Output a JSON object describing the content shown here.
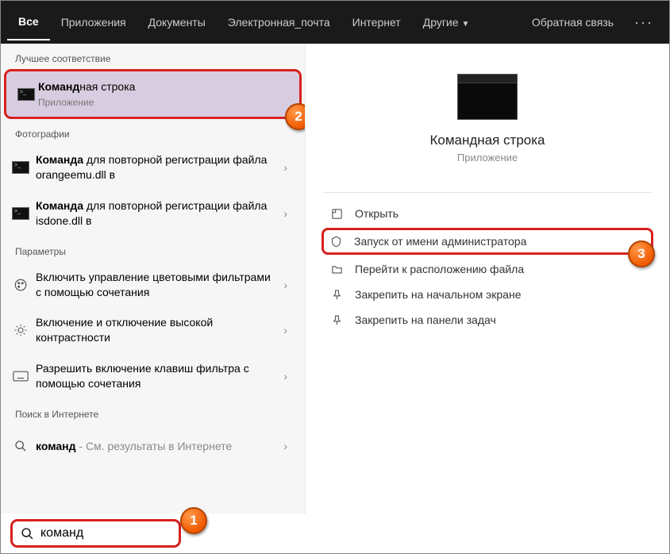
{
  "topbar": {
    "tabs": [
      {
        "label": "Все",
        "active": true
      },
      {
        "label": "Приложения"
      },
      {
        "label": "Документы"
      },
      {
        "label": "Электронная_почта"
      },
      {
        "label": "Интернет"
      },
      {
        "label": "Другие",
        "dropdown": true
      }
    ],
    "feedback": "Обратная связь"
  },
  "sections": {
    "best_match": "Лучшее соответствие",
    "photos": "Фотографии",
    "settings": "Параметры",
    "web": "Поиск в Интернете"
  },
  "results": {
    "best": {
      "bold": "Команд",
      "rest": "ная строка",
      "sub": "Приложение"
    },
    "photo1": {
      "bold": "Команда",
      "rest": " для повторной регистрации файла orangeemu.dll в"
    },
    "photo2": {
      "bold": "Команда",
      "rest": " для повторной регистрации файла isdone.dll в"
    },
    "set1": "Включить управление цветовыми фильтрами с помощью сочетания",
    "set2": "Включение и отключение высокой контрастности",
    "set3": "Разрешить включение клавиш фильтра с помощью сочетания",
    "web1": {
      "bold": "команд",
      "rest": " - См. результаты в Интернете"
    }
  },
  "preview": {
    "title": "Командная строка",
    "type": "Приложение",
    "actions": {
      "open": "Открыть",
      "runas": "Запуск от имени администратора",
      "location": "Перейти к расположению файла",
      "pin_start": "Закрепить на начальном экране",
      "pin_taskbar": "Закрепить на панели задач"
    }
  },
  "search": {
    "value": "команд"
  },
  "badges": {
    "b1": "1",
    "b2": "2",
    "b3": "3"
  }
}
